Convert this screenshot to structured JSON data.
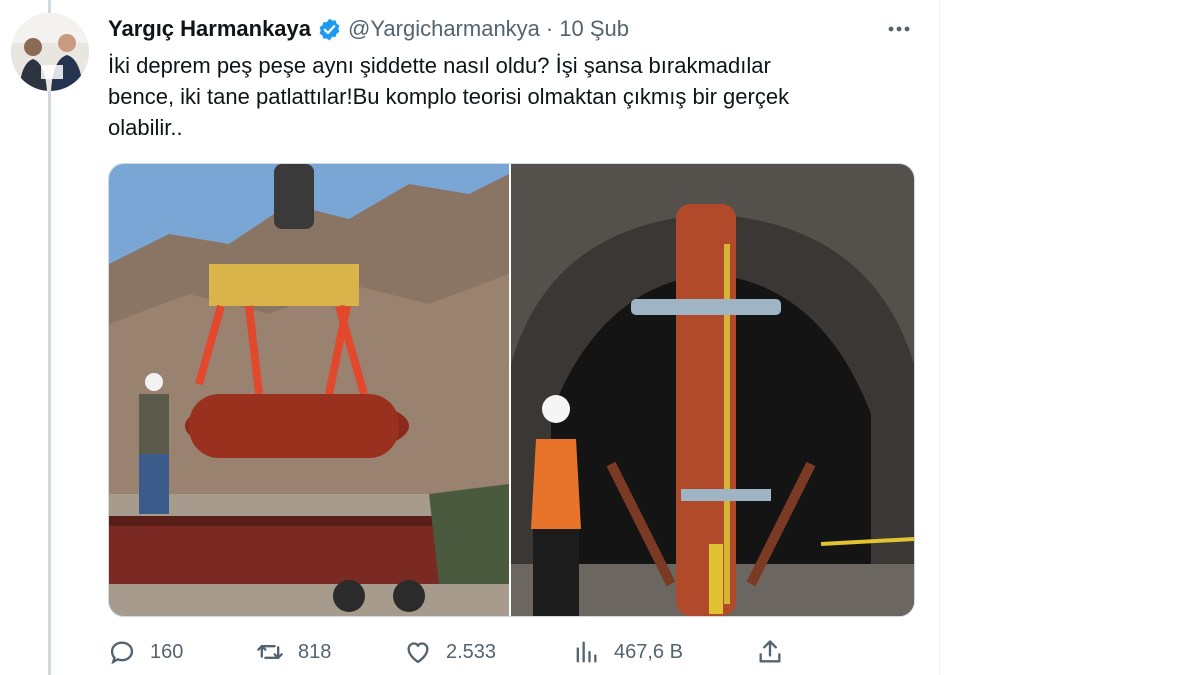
{
  "tweet": {
    "author": {
      "display_name": "Yargıç Harmankaya",
      "handle": "@Yargicharmankya",
      "verified": true,
      "avatar_icon": "profile-photo"
    },
    "separator": "·",
    "date": "10 Şub",
    "text_lines": [
      "İki deprem peş peşe aynı şiddette nasıl oldu? İşi şansa bırakmadılar",
      "bence, iki tane patlattılar!Bu komplo teorisi olmaktan çıkmış bir gerçek",
      "olabilir.."
    ],
    "media": [
      {
        "kind": "photo",
        "icon": "crane-lifting-bomb-photo"
      },
      {
        "kind": "photo",
        "icon": "tunnel-device-photo"
      }
    ],
    "actions": {
      "reply": {
        "icon": "reply-icon",
        "count": "160"
      },
      "retweet": {
        "icon": "retweet-icon",
        "count": "818"
      },
      "like": {
        "icon": "heart-icon",
        "count": "2.533"
      },
      "views": {
        "icon": "views-icon",
        "count": "467,6 B"
      },
      "share": {
        "icon": "share-icon"
      }
    }
  },
  "colors": {
    "text": "#0f1419",
    "secondary": "#536471",
    "verified": "#1d9bf0",
    "border": "#cfd9de"
  }
}
